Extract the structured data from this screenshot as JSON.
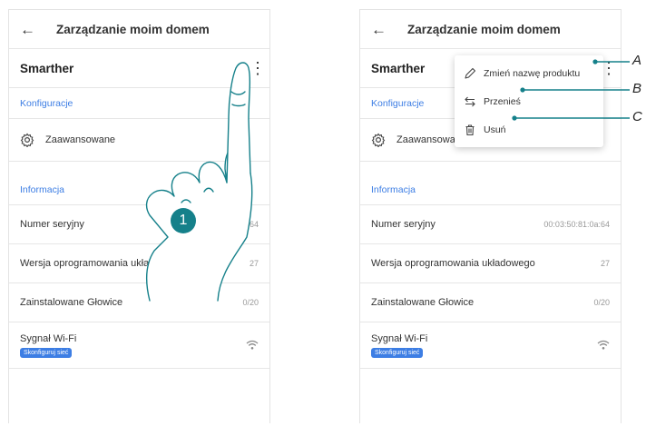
{
  "screen_title": "Zarządzanie moim domem",
  "product_name": "Smarther",
  "sections": {
    "config_label": "Konfiguracje",
    "advanced_label": "Zaawansowane",
    "info_label": "Informacja"
  },
  "info_rows": [
    {
      "label": "Numer seryjny",
      "value": "00:03:50:81:0a:64"
    },
    {
      "label": "Wersja oprogramowania układowego",
      "value": "27"
    },
    {
      "label": "Zainstalowane Głowice",
      "value": "0/20"
    }
  ],
  "wifi": {
    "label": "Sygnał Wi-Fi",
    "configure_label": "Skonfiguruj sieć"
  },
  "step_number": "1",
  "menu": {
    "rename_label": "Zmień nazwę produktu",
    "move_label": "Przenieś",
    "delete_label": "Usuń"
  },
  "callouts": {
    "a": "A",
    "b": "B",
    "c": "C"
  },
  "colors": {
    "accent": "#3d7ee4",
    "callout": "#15808a"
  }
}
